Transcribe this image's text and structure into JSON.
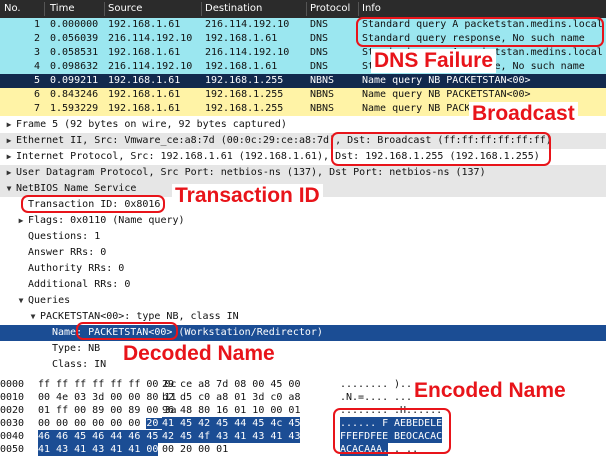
{
  "packet_list": {
    "columns": [
      "No.",
      "Time",
      "Source",
      "Destination",
      "Protocol",
      "Info"
    ],
    "rows": [
      {
        "no": "1",
        "time": "0.000000",
        "src": "192.168.1.61",
        "dst": "216.114.192.10",
        "proto": "DNS",
        "info": "Standard query A packetstan.medins.local",
        "color": "#9be7f0"
      },
      {
        "no": "2",
        "time": "0.056039",
        "src": "216.114.192.10",
        "dst": "192.168.1.61",
        "proto": "DNS",
        "info": "Standard query response, No such name",
        "color": "#9be7f0"
      },
      {
        "no": "3",
        "time": "0.058531",
        "src": "192.168.1.61",
        "dst": "216.114.192.10",
        "proto": "DNS",
        "info": "Standard query A packetstan.medins.local",
        "color": "#9be7f0"
      },
      {
        "no": "4",
        "time": "0.098632",
        "src": "216.114.192.10",
        "dst": "192.168.1.61",
        "proto": "DNS",
        "info": "Standard query response, No such name",
        "color": "#9be7f0"
      },
      {
        "no": "5",
        "time": "0.099211",
        "src": "192.168.1.61",
        "dst": "192.168.1.255",
        "proto": "NBNS",
        "info": "Name query NB PACKETSTAN<00>",
        "color": "#12294d"
      },
      {
        "no": "6",
        "time": "0.843246",
        "src": "192.168.1.61",
        "dst": "192.168.1.255",
        "proto": "NBNS",
        "info": "Name query NB PACKETSTAN<00>",
        "color": "#fff3a6"
      },
      {
        "no": "7",
        "time": "1.593229",
        "src": "192.168.1.61",
        "dst": "192.168.1.255",
        "proto": "NBNS",
        "info": "Name query NB PACKETSTAN<00>",
        "color": "#fff3a6"
      }
    ]
  },
  "details": {
    "rows": [
      {
        "indent": 0,
        "arrow": "closed",
        "text": "Frame 5 (92 bytes on wire, 92 bytes captured)",
        "style": "plain"
      },
      {
        "indent": 0,
        "arrow": "closed",
        "text": "Ethernet II, Src: Vmware_ce:a8:7d (00:0c:29:ce:a8:7d), Dst: Broadcast (ff:ff:ff:ff:ff:ff)",
        "style": "hdr"
      },
      {
        "indent": 0,
        "arrow": "closed",
        "text": "Internet Protocol, Src: 192.168.1.61 (192.168.1.61), Dst: 192.168.1.255 (192.168.1.255)",
        "style": "plain"
      },
      {
        "indent": 0,
        "arrow": "closed",
        "text": "User Datagram Protocol, Src Port: netbios-ns (137), Dst Port: netbios-ns (137)",
        "style": "hdr"
      },
      {
        "indent": 0,
        "arrow": "open",
        "text": "NetBIOS Name Service",
        "style": "hdr"
      },
      {
        "indent": 1,
        "arrow": "none",
        "text": "Transaction ID: 0x8016",
        "style": "plain"
      },
      {
        "indent": 1,
        "arrow": "closed",
        "text": "Flags: 0x0110 (Name query)",
        "style": "plain"
      },
      {
        "indent": 1,
        "arrow": "none",
        "text": "Questions: 1",
        "style": "plain"
      },
      {
        "indent": 1,
        "arrow": "none",
        "text": "Answer RRs: 0",
        "style": "plain"
      },
      {
        "indent": 1,
        "arrow": "none",
        "text": "Authority RRs: 0",
        "style": "plain"
      },
      {
        "indent": 1,
        "arrow": "none",
        "text": "Additional RRs: 0",
        "style": "plain"
      },
      {
        "indent": 1,
        "arrow": "open",
        "text": "Queries",
        "style": "plain"
      },
      {
        "indent": 2,
        "arrow": "open",
        "text": "PACKETSTAN<00>: type NB, class IN",
        "style": "plain"
      },
      {
        "indent": 3,
        "arrow": "none",
        "text": "Name: PACKETSTAN<00> (Workstation/Redirector)",
        "style": "sel"
      },
      {
        "indent": 3,
        "arrow": "none",
        "text": "Type: NB",
        "style": "plain"
      },
      {
        "indent": 3,
        "arrow": "none",
        "text": "Class: IN",
        "style": "plain"
      }
    ]
  },
  "bytes": {
    "rows": [
      {
        "off": "0000",
        "hex_a": "ff ff ff ff ff ff 00 0c",
        "hex_b": "29 ce a8 7d 08 00 45 00",
        "asc_a": "........",
        "asc_b": " )..}..E.",
        "hl_a": "",
        "hl_b": ""
      },
      {
        "off": "0010",
        "hex_a": "00 4e 03 3d 00 00 80 11",
        "hex_b": "b2 d5 c0 a8 01 3d c0 a8",
        "asc_a": ".N.=....",
        "asc_b": " .....=..",
        "hl_a": "",
        "hl_b": ""
      },
      {
        "off": "0020",
        "hex_a": "01 ff 00 89 00 89 00 3a",
        "hex_b": "96 48 80 16 01 10 00 01",
        "asc_a": ".......:",
        "asc_b": " .H......",
        "hl_a": "",
        "hl_b": ""
      },
      {
        "off": "0030",
        "hex_a": "00 00 00 00 00 00 20 46",
        "hex_b": "41 45 42 45 44 45 4c 45",
        "asc_a": "...... F",
        "asc_b": " AEBEDELE",
        "hl_a": "20 46",
        "hl_b": "41 45 42 45 44 45 4c 45"
      },
      {
        "off": "0040",
        "hex_a": "46 46 45 46 44 46 45 45",
        "hex_b": "42 45 4f 43 41 43 41 43",
        "asc_a": "FFEFDFEE",
        "asc_b": " BEOCACAC",
        "hl_a": "46 46 45 46 44 46 45 45",
        "hl_b": "42 45 4f 43 41 43 41 43"
      },
      {
        "off": "0050",
        "hex_a": "41 43 41 43 41 41 00",
        "hex_b": "00 20 00 01",
        "asc_a": "ACACAAA.",
        "asc_b": " . ..",
        "hl_a": "41 43 41 43 41 41 00",
        "hl_b": ""
      }
    ]
  },
  "annotations": {
    "dns_failure": "DNS Failure",
    "broadcast": "Broadcast",
    "transaction_id": "Transaction ID",
    "decoded_name": "Decoded Name",
    "encoded_name": "Encoded Name"
  },
  "colors": {
    "dns_row": "#9be7f0",
    "nbns_row": "#fff3a6",
    "selected": "#1b4d94",
    "annotation": "#e8141a"
  }
}
